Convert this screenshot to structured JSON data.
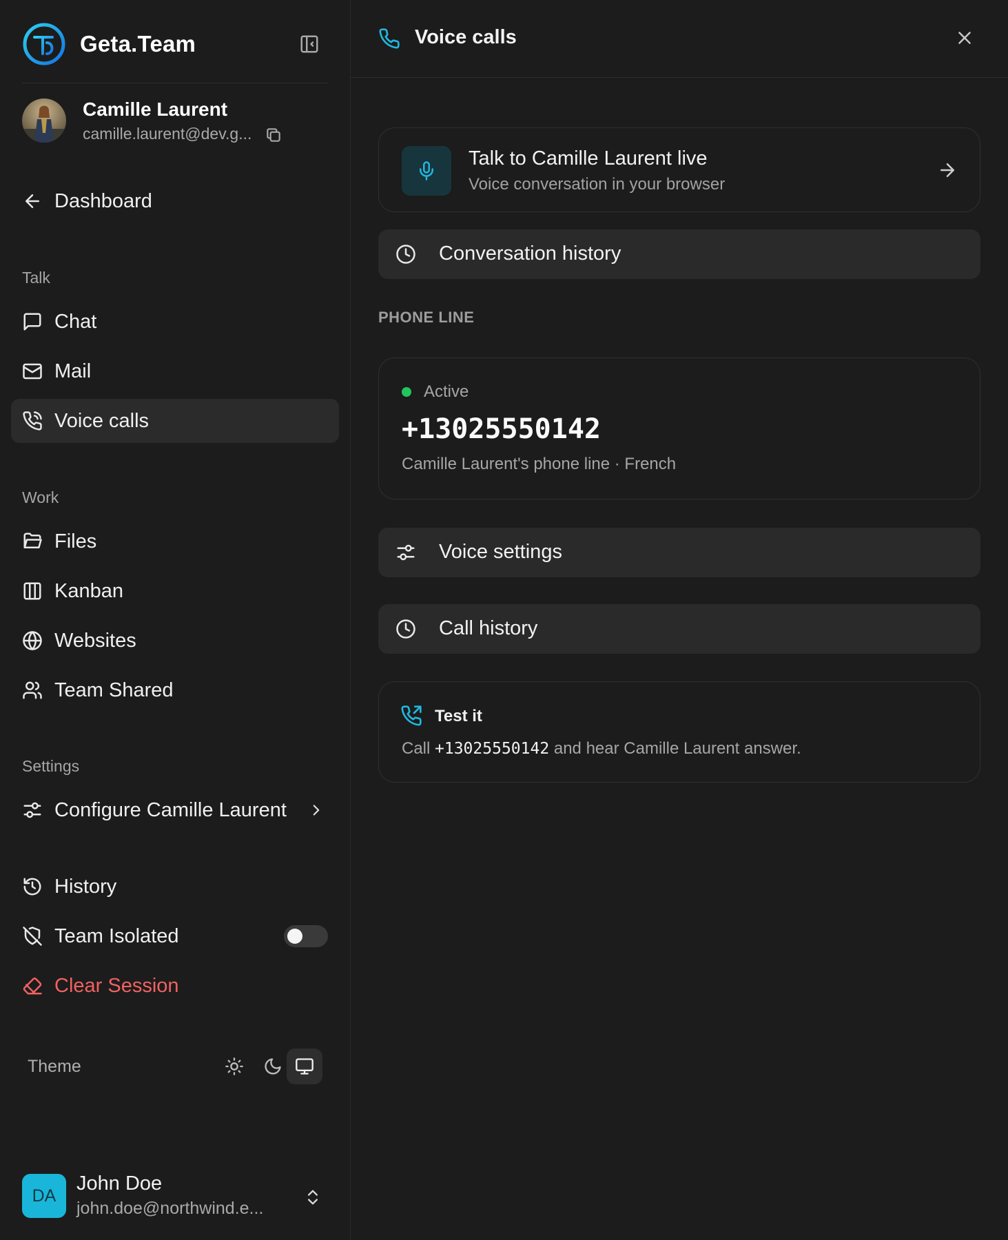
{
  "brand": {
    "name": "Geta.Team",
    "accent": "#1fb8e0"
  },
  "agent": {
    "name": "Camille Laurent",
    "email": "camille.laurent@dev.g..."
  },
  "nav": {
    "dashboard": "Dashboard",
    "talk_section": "Talk",
    "talk_items": [
      {
        "label": "Chat",
        "icon": "chat-icon"
      },
      {
        "label": "Mail",
        "icon": "mail-icon"
      },
      {
        "label": "Voice calls",
        "icon": "phone-call-icon",
        "active": true
      }
    ],
    "work_section": "Work",
    "work_items": [
      {
        "label": "Files",
        "icon": "folder-icon"
      },
      {
        "label": "Kanban",
        "icon": "kanban-icon"
      },
      {
        "label": "Websites",
        "icon": "globe-icon"
      },
      {
        "label": "Team Shared",
        "icon": "users-icon"
      }
    ],
    "settings_section": "Settings",
    "configure": "Configure Camille Laurent",
    "history": "History",
    "team_isolated": "Team Isolated",
    "team_isolated_on": false,
    "clear_session": "Clear Session"
  },
  "theme": {
    "label": "Theme",
    "options": [
      "light",
      "dark",
      "system"
    ],
    "selected": "system"
  },
  "user": {
    "initials": "DA",
    "name": "John Doe",
    "email": "john.doe@northwind.e..."
  },
  "panel": {
    "title": "Voice calls",
    "live": {
      "title": "Talk to Camille Laurent live",
      "subtitle": "Voice conversation in your browser"
    },
    "conversation_history": "Conversation history",
    "phone_line_section": "PHONE LINE",
    "line": {
      "status": "Active",
      "status_color": "#22c55e",
      "number": "+13025550142",
      "description": "Camille Laurent's phone line · French"
    },
    "voice_settings": "Voice settings",
    "call_history": "Call history",
    "test": {
      "title": "Test it",
      "prefix": "Call ",
      "number": "+13025550142",
      "suffix": " and hear Camille Laurent answer."
    }
  }
}
